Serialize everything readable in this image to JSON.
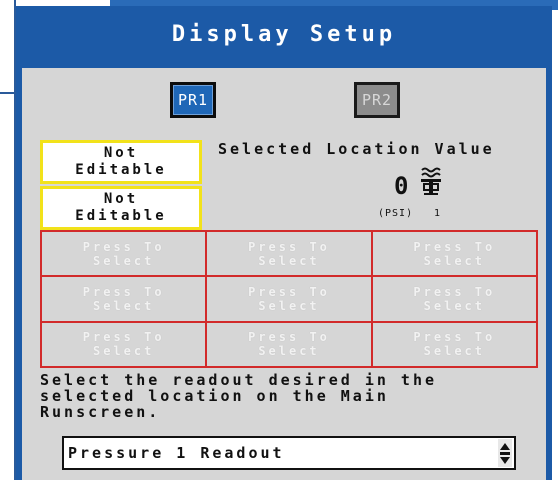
{
  "window": {
    "title": "Display Setup"
  },
  "buttons": {
    "pr1": "PR1",
    "pr2": "PR2"
  },
  "not_editable": [
    {
      "line1": "Not",
      "line2": "Editable"
    },
    {
      "line1": "Not",
      "line2": "Editable"
    }
  ],
  "selected_location": {
    "label": "Selected Location Value",
    "value": "0",
    "unit": "(PSI)",
    "index": "1",
    "icon": "pressure-gauge-icon"
  },
  "grid_cells": [
    {
      "line1": "Press To",
      "line2": "Select"
    },
    {
      "line1": "Press To",
      "line2": "Select"
    },
    {
      "line1": "Press To",
      "line2": "Select"
    },
    {
      "line1": "Press To",
      "line2": "Select"
    },
    {
      "line1": "Press To",
      "line2": "Select"
    },
    {
      "line1": "Press To",
      "line2": "Select"
    },
    {
      "line1": "Press To",
      "line2": "Select"
    },
    {
      "line1": "Press To",
      "line2": "Select"
    },
    {
      "line1": "Press To",
      "line2": "Select"
    }
  ],
  "instructions": {
    "line1": "Select the readout desired in the",
    "line2": "selected location on the Main",
    "line3": "Runscreen."
  },
  "readout_select": {
    "value": "Pressure 1 Readout"
  },
  "colors": {
    "panel": "#1c5aa7",
    "content": "#d6d6d6",
    "grid_border": "#d22a2a",
    "not_editable_border": "#f2e21a"
  }
}
